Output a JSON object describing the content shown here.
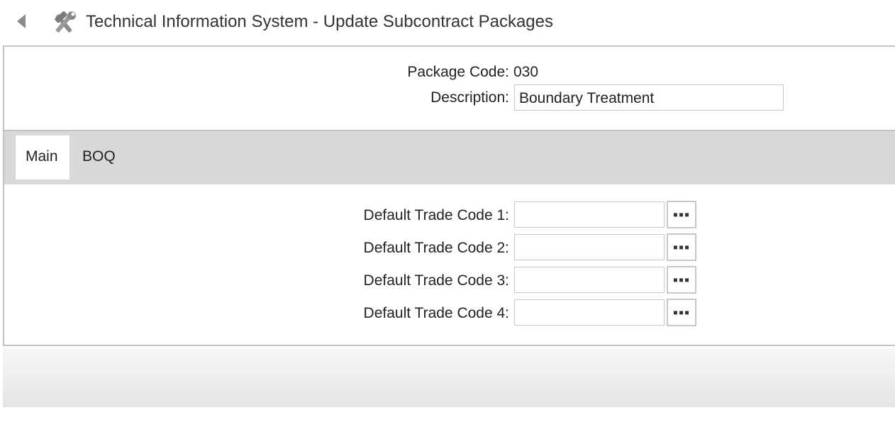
{
  "window": {
    "title": "Technical Information System - Update Subcontract Packages",
    "back_icon": "back-arrow-icon",
    "app_icon": "tools-icon"
  },
  "header": {
    "package_code_label": "Package Code:",
    "package_code_value": "030",
    "description_label": "Description:",
    "description_value": "Boundary Treatment"
  },
  "tabs": [
    {
      "label": "Main",
      "selected": true
    },
    {
      "label": "BOQ",
      "selected": false
    }
  ],
  "main": {
    "trade_codes": [
      {
        "label": "Default Trade Code 1:",
        "value": "",
        "lookup_label": "▪▪▪"
      },
      {
        "label": "Default Trade Code 2:",
        "value": "",
        "lookup_label": "▪▪▪"
      },
      {
        "label": "Default Trade Code 3:",
        "value": "",
        "lookup_label": "▪▪▪"
      },
      {
        "label": "Default Trade Code 4:",
        "value": "",
        "lookup_label": "▪▪▪"
      }
    ]
  },
  "colors": {
    "tabbar_bg": "#d8d8d8",
    "border": "#c2c2c2",
    "text": "#222222"
  }
}
